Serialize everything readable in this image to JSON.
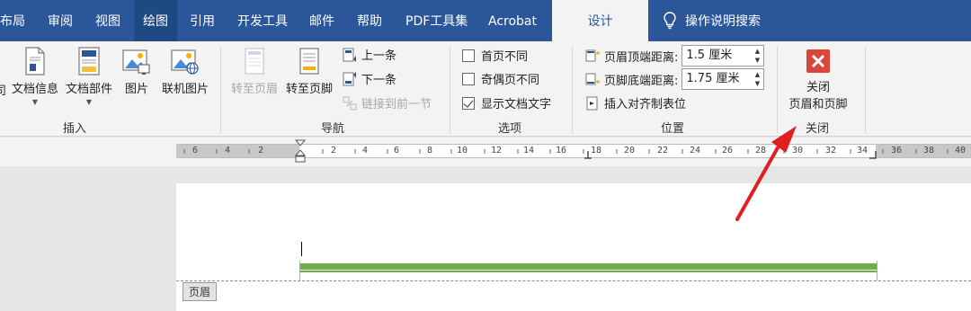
{
  "tabs": [
    {
      "label": "布局"
    },
    {
      "label": "审阅"
    },
    {
      "label": "视图"
    },
    {
      "label": "绘图"
    },
    {
      "label": "引用"
    },
    {
      "label": "开发工具"
    },
    {
      "label": "邮件"
    },
    {
      "label": "帮助"
    },
    {
      "label": "PDF工具集"
    },
    {
      "label": "Acrobat"
    },
    {
      "label": "设计"
    }
  ],
  "search_label": "操作说明搜索",
  "insert_group": {
    "label": "插入",
    "cut_left": "司",
    "doc_info": "文档信息",
    "doc_parts": "文档部件",
    "picture": "图片",
    "online_picture": "联机图片"
  },
  "nav_group": {
    "label": "导航",
    "goto_header": "转至页眉",
    "goto_footer": "转至页脚",
    "previous": "上一条",
    "next": "下一条",
    "link_previous": "链接到前一节"
  },
  "options_group": {
    "label": "选项",
    "first_page": "首页不同",
    "odd_even": "奇偶页不同",
    "show_doc_text": "显示文档文字",
    "first_page_checked": false,
    "odd_even_checked": false,
    "show_doc_text_checked": true
  },
  "position_group": {
    "label": "位置",
    "header_from_top_label": "页眉顶端距离:",
    "header_from_top_value": "1.5 厘米",
    "footer_from_bottom_label": "页脚底端距离:",
    "footer_from_bottom_value": "1.75 厘米",
    "insert_align_tab": "插入对齐制表位"
  },
  "close_group": {
    "label": "关闭",
    "close_line1": "关闭",
    "close_line2": "页眉和页脚"
  },
  "ruler_labels": [
    "6",
    "4",
    "2",
    "",
    "2",
    "4",
    "6",
    "8",
    "10",
    "12",
    "14",
    "16",
    "18",
    "20",
    "22",
    "24",
    "26",
    "28",
    "30",
    "32",
    "34",
    "36",
    "38",
    "40"
  ],
  "document": {
    "header_tag": "页眉"
  },
  "colors": {
    "ribbon_blue": "#2b579a",
    "header_rule_green": "#70ad47",
    "close_red": "#d9463a",
    "annotation_arrow": "#e02020"
  }
}
